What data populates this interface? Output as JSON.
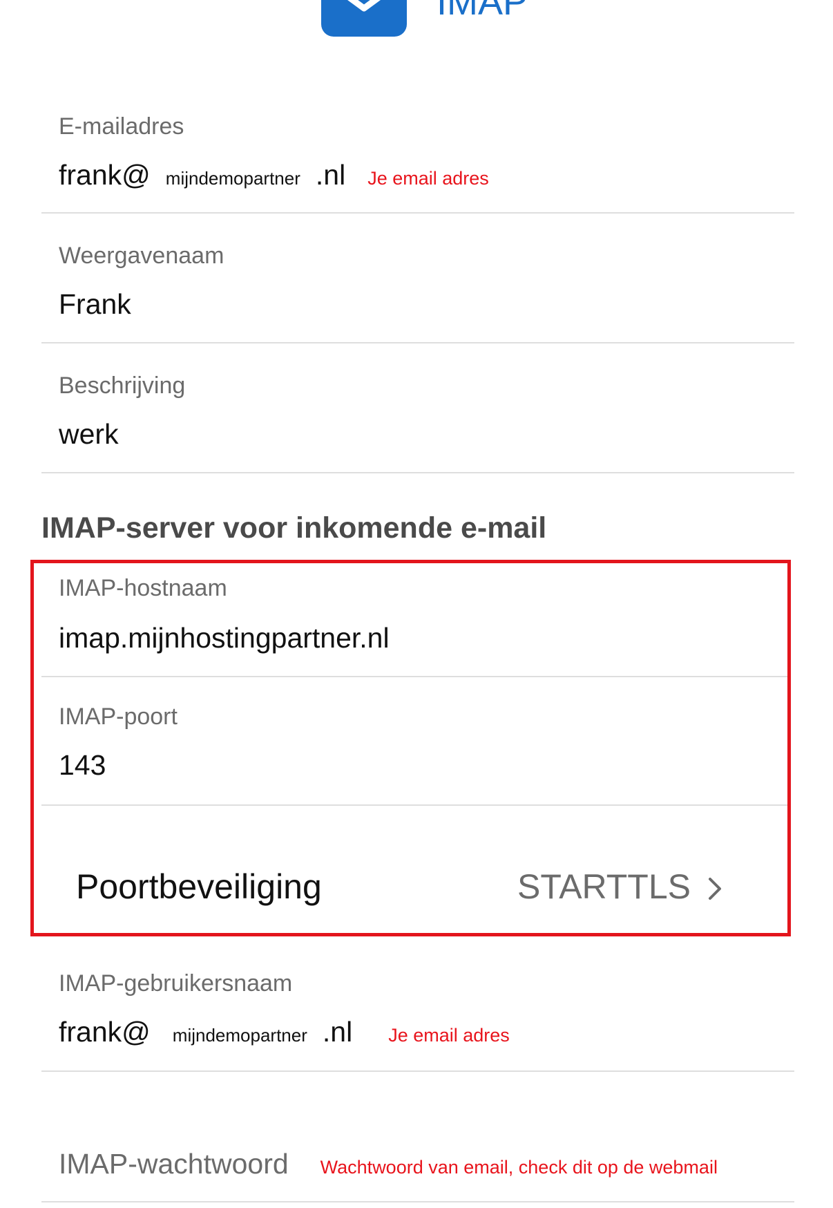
{
  "header": {
    "app_title": "IMAP",
    "icon": "mail-envelope-icon",
    "accent_color": "#1a6fc9"
  },
  "fields": {
    "email": {
      "label": "E-mailadres",
      "value_prefix": "frank@",
      "value_domain": "mijndemopartner",
      "value_suffix": ".nl",
      "annotation": "Je email adres"
    },
    "display_name": {
      "label": "Weergavenaam",
      "value": "Frank"
    },
    "description": {
      "label": "Beschrijving",
      "value": "werk"
    }
  },
  "incoming": {
    "section_title": "IMAP-server voor inkomende e-mail",
    "hostname": {
      "label": "IMAP-hostnaam",
      "value": "imap.mijnhostingpartner.nl"
    },
    "port": {
      "label": "IMAP-poort",
      "value": "143"
    },
    "security": {
      "label": "Poortbeveiliging",
      "value": "STARTTLS"
    },
    "username": {
      "label": "IMAP-gebruikersnaam",
      "value_prefix": "frank@",
      "value_domain": "mijndemopartner",
      "value_suffix": ".nl",
      "annotation": "Je email adres"
    },
    "password": {
      "label": "IMAP-wachtwoord",
      "annotation": "Wachtwoord van email, check dit op de webmail"
    }
  },
  "colors": {
    "annotation_red": "#e8141c",
    "highlight_border": "#e3151c",
    "label_gray": "#6b6b6b"
  }
}
